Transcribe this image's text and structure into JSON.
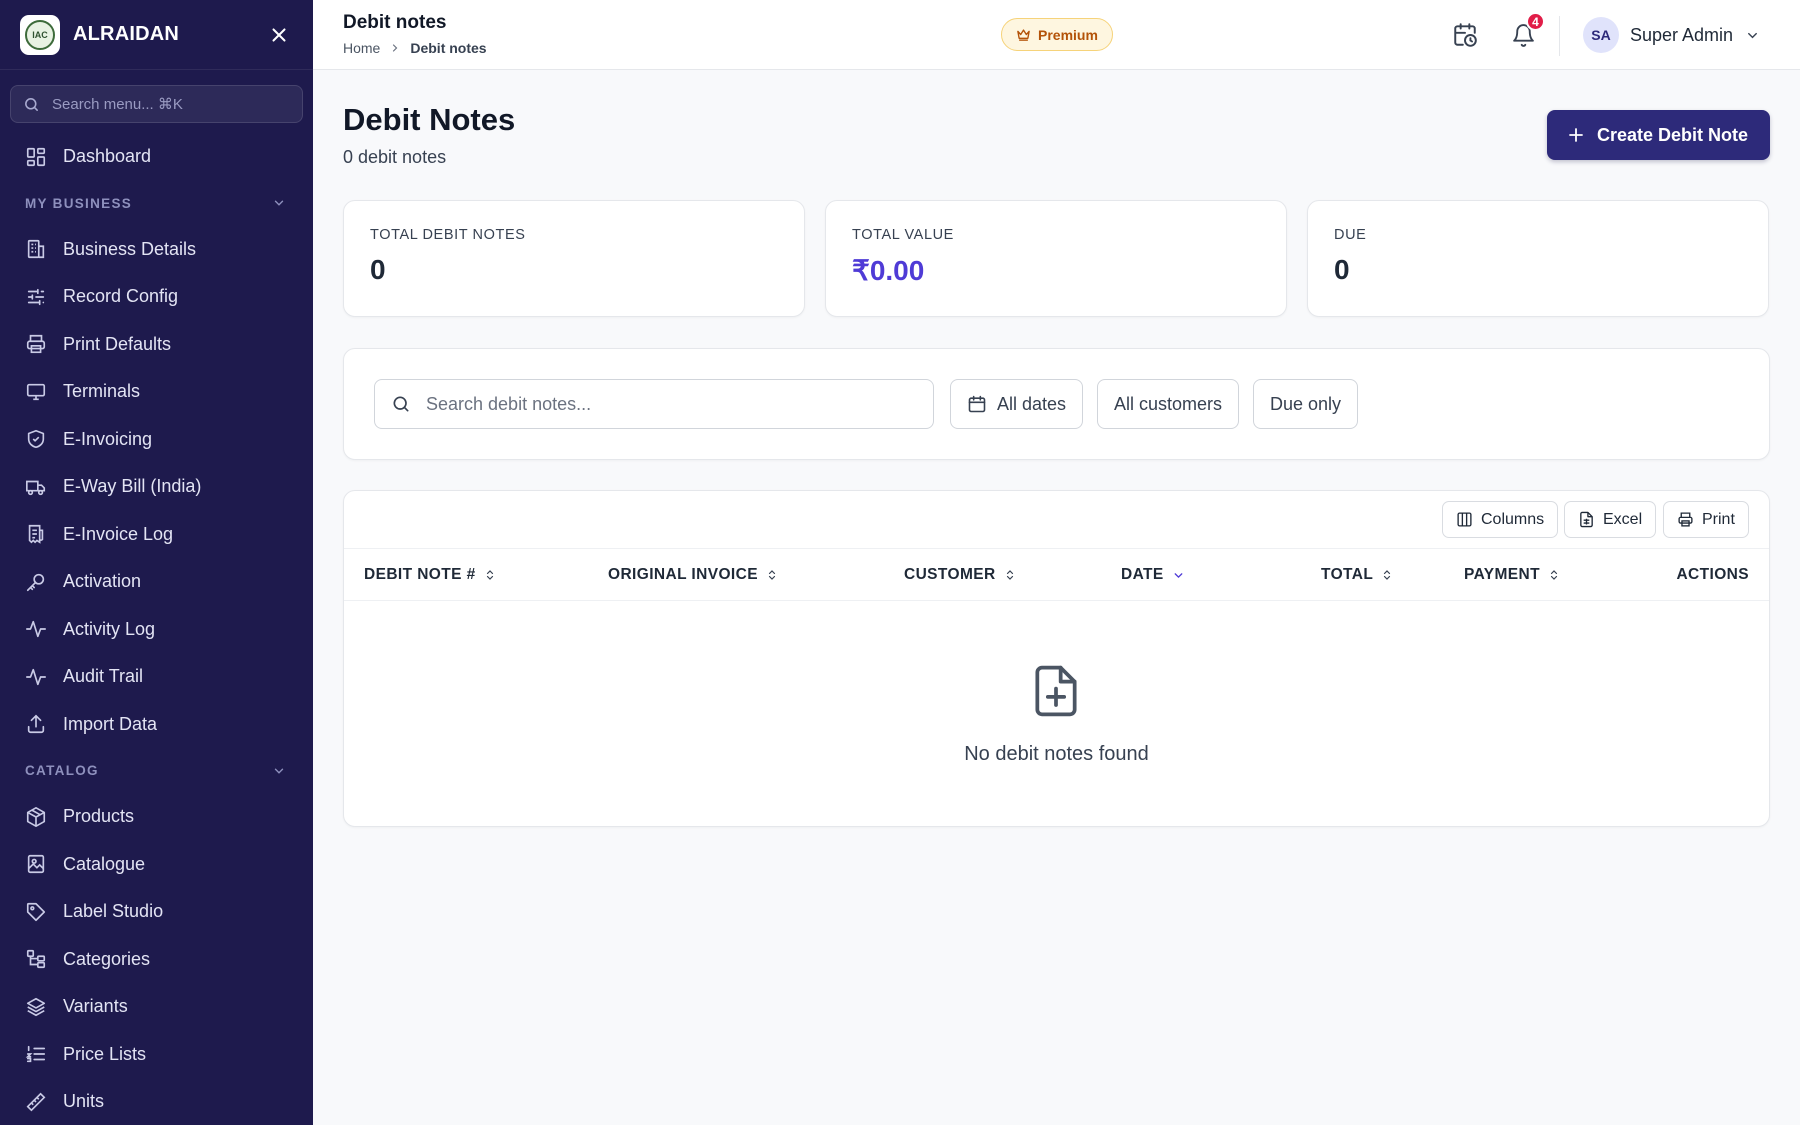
{
  "sidebar": {
    "brand_name": "ALRAIDAN",
    "logo_text": "IAC",
    "search_placeholder": "Search menu... ⌘K",
    "dashboard_label": "Dashboard",
    "section_business": "MY BUSINESS",
    "business_items": [
      {
        "label": "Business Details",
        "icon": "building-icon"
      },
      {
        "label": "Record Config",
        "icon": "sliders-icon"
      },
      {
        "label": "Print Defaults",
        "icon": "printer-icon"
      },
      {
        "label": "Terminals",
        "icon": "monitor-icon"
      },
      {
        "label": "E-Invoicing",
        "icon": "shield-check-icon"
      },
      {
        "label": "E-Way Bill (India)",
        "icon": "truck-icon"
      },
      {
        "label": "E-Invoice Log",
        "icon": "receipt-icon"
      },
      {
        "label": "Activation",
        "icon": "key-icon"
      },
      {
        "label": "Activity Log",
        "icon": "activity-icon"
      },
      {
        "label": "Audit Trail",
        "icon": "activity-icon"
      },
      {
        "label": "Import Data",
        "icon": "upload-icon"
      }
    ],
    "section_catalog": "CATALOG",
    "catalog_items": [
      {
        "label": "Products",
        "icon": "box-icon"
      },
      {
        "label": "Catalogue",
        "icon": "image-book-icon"
      },
      {
        "label": "Label Studio",
        "icon": "tag-icon"
      },
      {
        "label": "Categories",
        "icon": "hierarchy-icon"
      },
      {
        "label": "Variants",
        "icon": "layers-icon"
      },
      {
        "label": "Price Lists",
        "icon": "list-ordered-icon"
      },
      {
        "label": "Units",
        "icon": "ruler-icon"
      }
    ]
  },
  "topbar": {
    "title": "Debit notes",
    "breadcrumb_home": "Home",
    "breadcrumb_current": "Debit notes",
    "premium_label": "Premium",
    "notification_count": "4",
    "user_initials": "SA",
    "user_name": "Super Admin"
  },
  "page": {
    "title": "Debit Notes",
    "subtitle": "0 debit notes",
    "create_button": "Create Debit Note"
  },
  "stats": [
    {
      "label": "TOTAL DEBIT NOTES",
      "value": "0"
    },
    {
      "label": "TOTAL VALUE",
      "value": "₹0.00"
    },
    {
      "label": "DUE",
      "value": "0"
    }
  ],
  "filters": {
    "search_placeholder": "Search debit notes...",
    "date_filter": "All dates",
    "customer_filter": "All customers",
    "due_filter": "Due only"
  },
  "table": {
    "tools": {
      "columns": "Columns",
      "excel": "Excel",
      "print": "Print"
    },
    "headers": [
      "DEBIT NOTE #",
      "ORIGINAL INVOICE",
      "CUSTOMER",
      "DATE",
      "TOTAL",
      "PAYMENT",
      "ACTIONS"
    ],
    "empty_message": "No debit notes found"
  },
  "colors": {
    "sidebar_bg": "#1e1a4d",
    "primary": "#2d2a7a",
    "accent_value": "#4f3bd6",
    "badge": "#e11d48",
    "premium_text": "#b45309"
  }
}
